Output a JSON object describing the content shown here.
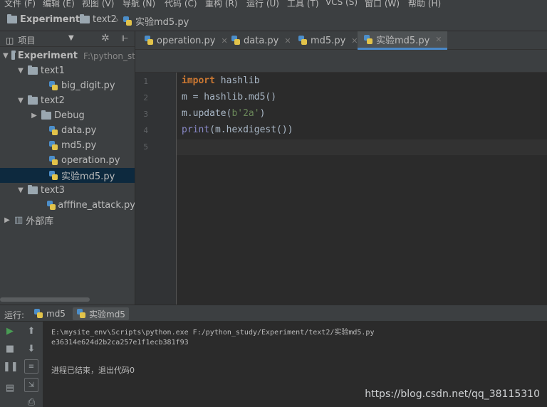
{
  "menu": [
    "文件 (F)",
    "编辑 (E)",
    "视图 (V)",
    "导航 (N)",
    "代码 (C)",
    "重构 (R)",
    "运行 (U)",
    "工具 (T)",
    "VCS (S)",
    "窗口 (W)",
    "帮助 (H)"
  ],
  "breadcrumb": [
    "Experiment",
    "text2",
    "实验md5.py"
  ],
  "project": {
    "title": "项目",
    "tree": [
      {
        "label": "Experiment",
        "path": "F:\\python_st",
        "depth": 0,
        "type": "folder",
        "expanded": true
      },
      {
        "label": "text1",
        "depth": 1,
        "type": "folder",
        "expanded": true
      },
      {
        "label": "big_digit.py",
        "depth": 2,
        "type": "py"
      },
      {
        "label": "text2",
        "depth": 1,
        "type": "folder",
        "expanded": true
      },
      {
        "label": "Debug",
        "depth": 2,
        "type": "folder",
        "expanded": false
      },
      {
        "label": "data.py",
        "depth": 2,
        "type": "py"
      },
      {
        "label": "md5.py",
        "depth": 2,
        "type": "py"
      },
      {
        "label": "operation.py",
        "depth": 2,
        "type": "py"
      },
      {
        "label": "实验md5.py",
        "depth": 2,
        "type": "py",
        "selected": true
      },
      {
        "label": "text3",
        "depth": 1,
        "type": "folder",
        "expanded": true
      },
      {
        "label": "afffine_attack.py",
        "depth": 2,
        "type": "py"
      },
      {
        "label": "外部库",
        "depth": 0,
        "type": "lib",
        "expanded": false
      }
    ]
  },
  "tabs": [
    {
      "label": "operation.py"
    },
    {
      "label": "data.py"
    },
    {
      "label": "md5.py"
    },
    {
      "label": "实验md5.py",
      "active": true
    }
  ],
  "editor": {
    "line_numbers": [
      "1",
      "2",
      "3",
      "4",
      "5"
    ],
    "lines": [
      [
        {
          "t": "import",
          "c": "kw"
        },
        {
          "t": " hashlib",
          "c": ""
        }
      ],
      [
        {
          "t": "m = hashlib.md5()",
          "c": ""
        }
      ],
      [
        {
          "t": "m.update(",
          "c": ""
        },
        {
          "t": "b'2a'",
          "c": "str"
        },
        {
          "t": ")",
          "c": ""
        }
      ],
      [
        {
          "t": "print",
          "c": "fn"
        },
        {
          "t": "(m.hexdigest())",
          "c": ""
        }
      ],
      []
    ]
  },
  "run": {
    "title": "运行:",
    "tabs": [
      {
        "label": "md5"
      },
      {
        "label": "实验md5",
        "active": true
      }
    ],
    "console": [
      "E:\\mysite_env\\Scripts\\python.exe F:/python_study/Experiment/text2/实验md5.py",
      "e36314e624d2b2ca257e1f1ecb381f93",
      "",
      "进程已结束，退出代码0"
    ]
  },
  "watermark": "https://blog.csdn.net/qq_38115310",
  "colors": {
    "accent": "#4a88c7",
    "keyword": "#cc7832",
    "string": "#6a8759",
    "builtin": "#8888c6",
    "selection": "#0d293e"
  }
}
